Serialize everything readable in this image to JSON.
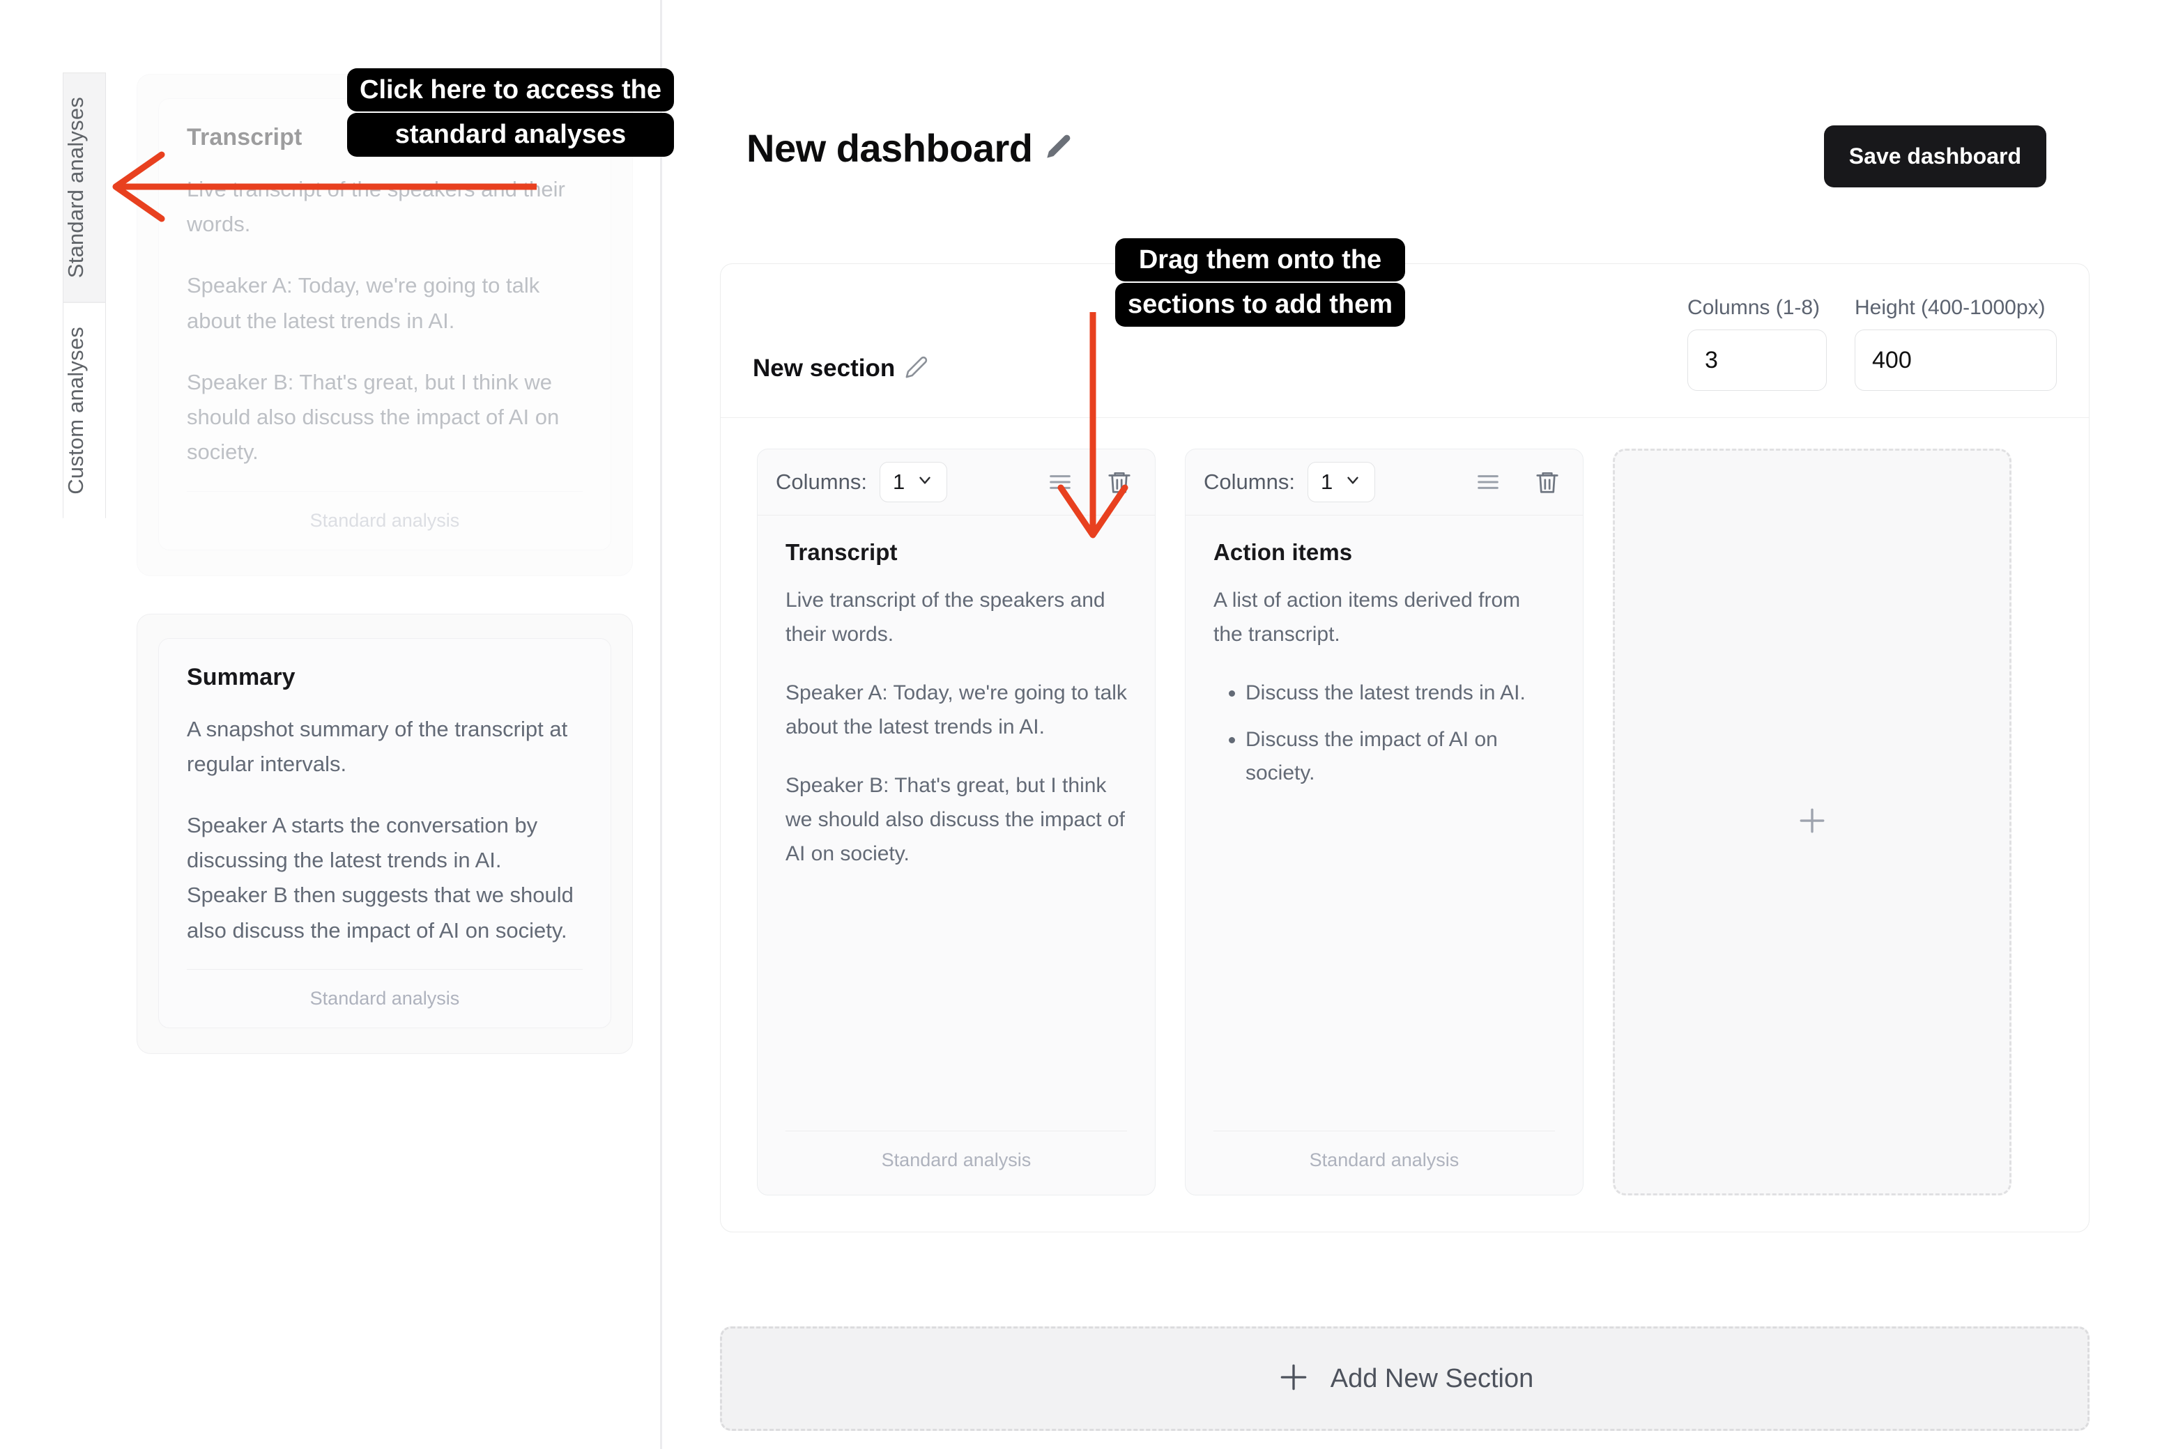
{
  "sidebar": {
    "tabs": [
      {
        "label": "Standard analyses",
        "active": true
      },
      {
        "label": "Custom analyses",
        "active": false
      }
    ],
    "cards": [
      {
        "title": "Transcript",
        "paragraphs": [
          "Live transcript of the speakers and their words.",
          "Speaker A: Today, we're going to talk about the latest trends in AI.",
          "Speaker B: That's great, but I think we should also discuss the impact of AI on society."
        ],
        "footer": "Standard analysis"
      },
      {
        "title": "Summary",
        "paragraphs": [
          "A snapshot summary of the transcript at regular intervals.",
          "Speaker A starts the conversation by discussing the latest trends in AI. Speaker B then suggests that we should also discuss the impact of AI on society."
        ],
        "footer": "Standard analysis"
      }
    ]
  },
  "header": {
    "title": "New dashboard",
    "edit_icon": "pencil-icon",
    "save_label": "Save dashboard"
  },
  "section": {
    "name": "New section",
    "edit_icon": "pencil-icon",
    "columns_label": "Columns (1-8)",
    "columns_value": "3",
    "height_label": "Height (400-1000px)",
    "height_value": "400",
    "widgets": [
      {
        "columns_label": "Columns:",
        "columns_value": "1",
        "drag_icon": "hamburger-drag-icon",
        "delete_icon": "trash-icon",
        "title": "Transcript",
        "paragraphs": [
          "Live transcript of the speakers and their words.",
          "Speaker A: Today, we're going to talk about the latest trends in AI.",
          "Speaker B: That's great, but I think we should also discuss the impact of AI on society."
        ],
        "bullets": [],
        "footer": "Standard analysis"
      },
      {
        "columns_label": "Columns:",
        "columns_value": "1",
        "drag_icon": "hamburger-drag-icon",
        "delete_icon": "trash-icon",
        "title": "Action items",
        "paragraphs": [
          "A list of action items derived from the transcript."
        ],
        "bullets": [
          "Discuss the latest trends in AI.",
          "Discuss the impact of AI on society."
        ],
        "footer": "Standard analysis"
      }
    ],
    "empty_slot_icon": "plus-icon"
  },
  "add_section": {
    "icon": "plus-icon",
    "label": "Add New Section"
  },
  "annotations": [
    {
      "id": "callout-standard-analyses",
      "line1": "Click here to access the",
      "line2": "standard analyses",
      "arrow": "arrow-left"
    },
    {
      "id": "callout-drag-sections",
      "line1": "Drag them onto the",
      "line2": "sections to add them",
      "arrow": "arrow-down"
    }
  ],
  "colors": {
    "accent_annotation": "#e8401f",
    "button_dark": "#18181b",
    "muted_text": "#636a76",
    "faint_text": "#aeb2bd"
  }
}
